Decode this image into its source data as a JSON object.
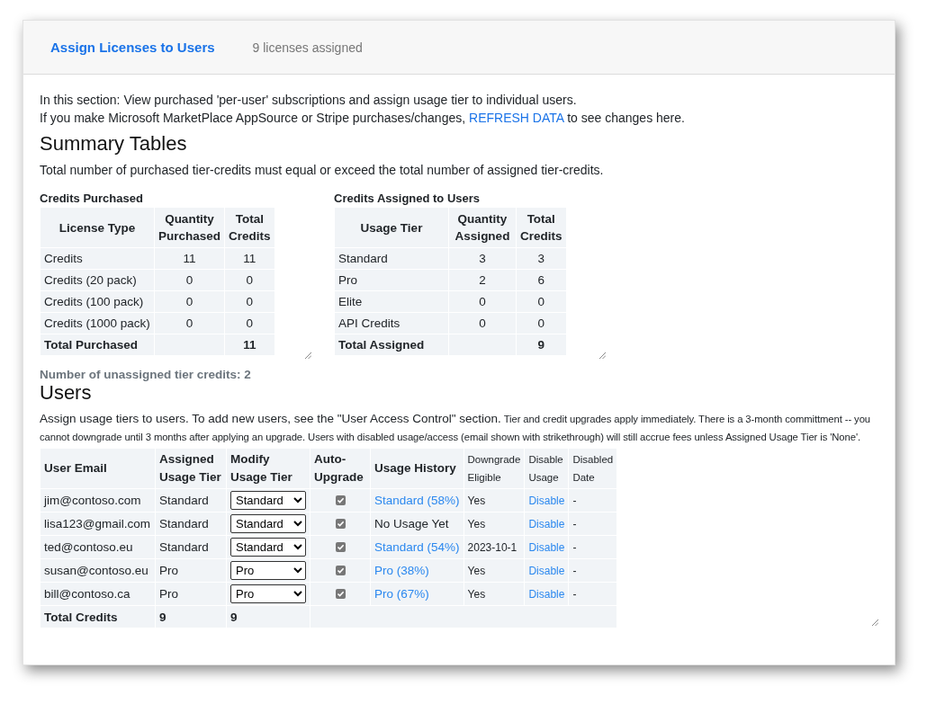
{
  "header": {
    "title": "Assign Licenses to Users",
    "subtitle": "9 licenses assigned"
  },
  "intro": {
    "line_1": "In this section: View purchased 'per-user' subscriptions and assign usage tier to individual users.",
    "line_2_before": "If you make Microsoft MarketPlace AppSource or Stripe purchases/changes, ",
    "line_2_link": "REFRESH DATA",
    "line_2_after": " to see changes here."
  },
  "summary": {
    "heading": "Summary Tables",
    "description": "Total number of purchased tier-credits must equal or exceed the total number of assigned tier-credits.",
    "tables": [
      {
        "caption": "Credits Purchased",
        "columns": [
          "License Type",
          "Quantity Purchased",
          "Total Credits"
        ],
        "rows": [
          [
            "Credits",
            "11",
            "11"
          ],
          [
            "Credits (20 pack)",
            "0",
            "0"
          ],
          [
            "Credits (100 pack)",
            "0",
            "0"
          ],
          [
            "Credits (1000 pack)",
            "0",
            "0"
          ]
        ],
        "total": {
          "label": "Total Purchased",
          "value": "11"
        }
      },
      {
        "caption": "Credits Assigned to Users",
        "columns": [
          "Usage Tier",
          "Quantity Assigned",
          "Total Credits"
        ],
        "rows": [
          [
            "Standard",
            "3",
            "3"
          ],
          [
            "Pro",
            "2",
            "6"
          ],
          [
            "Elite",
            "0",
            "0"
          ],
          [
            "API Credits",
            "0",
            "0"
          ]
        ],
        "total": {
          "label": "Total Assigned",
          "value": "9"
        }
      }
    ],
    "unassigned_note": "Number of unassigned tier credits: 2"
  },
  "users": {
    "heading": "Users",
    "description_lead": "Assign usage tiers to users. To add new users, see the \"User Access Control\" section.",
    "description_note": " Tier and credit upgrades apply immediately. There is a 3-month committment -- you cannot downgrade until 3 months after applying an upgrade. Users with disabled usage/access (email shown with strikethrough) will still accrue fees unless Assigned Usage Tier is 'None'.",
    "columns": [
      "User Email",
      "Assigned Usage Tier",
      "Modify Usage Tier",
      "Auto-Upgrade",
      "Usage History",
      "Downgrade Eligible",
      "Disable Usage",
      "Disabled Date"
    ],
    "rows": [
      {
        "email": "jim@contoso.com",
        "assigned_tier": "Standard",
        "modify_tier": "Standard",
        "auto_upgrade": true,
        "usage_history": {
          "kind": "link",
          "text": "Standard (58%)"
        },
        "downgrade_eligible": "Yes",
        "disable": "Disable",
        "disabled_date": "-"
      },
      {
        "email": "lisa123@gmail.com",
        "assigned_tier": "Standard",
        "modify_tier": "Standard",
        "auto_upgrade": true,
        "usage_history": {
          "kind": "text",
          "text": "No Usage Yet"
        },
        "downgrade_eligible": "Yes",
        "disable": "Disable",
        "disabled_date": "-"
      },
      {
        "email": "ted@contoso.eu",
        "assigned_tier": "Standard",
        "modify_tier": "Standard",
        "auto_upgrade": true,
        "usage_history": {
          "kind": "link",
          "text": "Standard (54%)"
        },
        "downgrade_eligible": "2023-10-1",
        "disable": "Disable",
        "disabled_date": "-"
      },
      {
        "email": "susan@contoso.eu",
        "assigned_tier": "Pro",
        "modify_tier": "Pro",
        "auto_upgrade": true,
        "usage_history": {
          "kind": "link",
          "text": "Pro (38%)"
        },
        "downgrade_eligible": "Yes",
        "disable": "Disable",
        "disabled_date": "-"
      },
      {
        "email": "bill@contoso.ca",
        "assigned_tier": "Pro",
        "modify_tier": "Pro",
        "auto_upgrade": true,
        "usage_history": {
          "kind": "link",
          "text": "Pro (67%)"
        },
        "downgrade_eligible": "Yes",
        "disable": "Disable",
        "disabled_date": "-"
      }
    ],
    "total": {
      "label": "Total Credits",
      "assigned": "9",
      "modified": "9"
    }
  }
}
